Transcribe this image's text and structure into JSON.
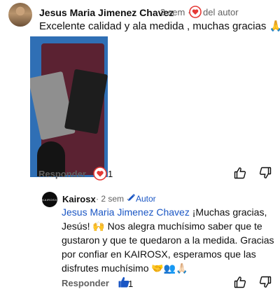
{
  "comment": {
    "author": "Jesus Maria Jimenez Chavez",
    "time": "· 3 sem ·",
    "creator_heart_label": "del autor",
    "text": "Excelente calidad y ala medida , muchas gracias 🙏",
    "reply_label": "Responder",
    "like_count": "1",
    "icons": [
      "creator-heart-icon",
      "heart-icon",
      "thumb-up-icon",
      "thumb-down-icon"
    ]
  },
  "reply": {
    "avatar_text": "KAIROSX",
    "author": "Kairosx",
    "time": "· 2 sem ·",
    "author_badge": "Autor",
    "mention": "Jesus Maria Jimenez Chavez",
    "text": " ¡Muchas gracias, Jesús! 🙌 Nos alegra muchísimo saber que te gustaron y que te quedaron a la medida. Gracias por confiar en KAIROSX, esperamos que las disfrutes muchísimo 🤝👥🙏🏻",
    "reply_label": "Responder",
    "like_count": "1",
    "icons": [
      "pencil-icon",
      "thumb-up-icon",
      "thumb-down-icon"
    ]
  },
  "colors": {
    "link": "#1a56c4",
    "heart": "#e53935",
    "muted": "#606060"
  }
}
